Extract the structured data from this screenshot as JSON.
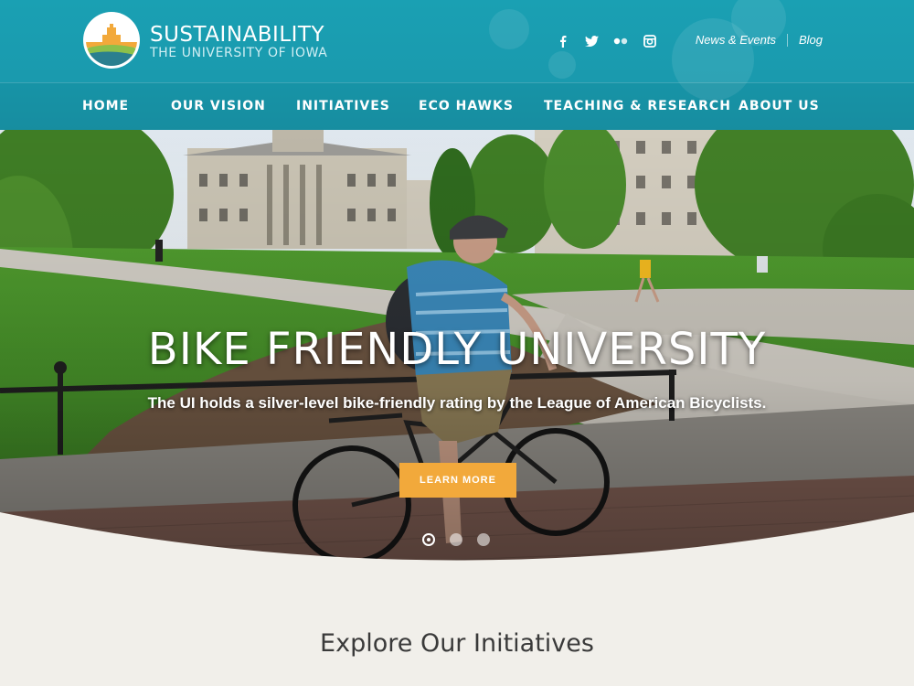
{
  "brand": {
    "title": "SUSTAINABILITY",
    "subtitle": "THE UNIVERSITY OF IOWA"
  },
  "social": [
    {
      "name": "facebook-icon",
      "glyph": "f"
    },
    {
      "name": "twitter-icon",
      "glyph": "t"
    },
    {
      "name": "flickr-icon",
      "glyph": "••"
    },
    {
      "name": "instagram-icon",
      "glyph": "◎"
    }
  ],
  "toplinks": {
    "news": "News & Events",
    "blog": "Blog"
  },
  "nav": {
    "home": "HOME",
    "vision": "OUR VISION",
    "initiatives": "INITIATIVES",
    "ecohawks": "ECO HAWKS",
    "teaching": "TEACHING & RESEARCH",
    "about": "ABOUT US"
  },
  "hero": {
    "title": "BIKE FRIENDLY UNIVERSITY",
    "subtitle": "The UI holds a silver-level bike-friendly rating by the League of American Bicyclists.",
    "cta": "LEARN MORE",
    "slides": 3,
    "active_slide": 1
  },
  "section": {
    "title": "Explore Our Initiatives"
  },
  "colors": {
    "header": "#1a9aae",
    "cta": "#f2a93b",
    "page_bg": "#f1efea"
  }
}
